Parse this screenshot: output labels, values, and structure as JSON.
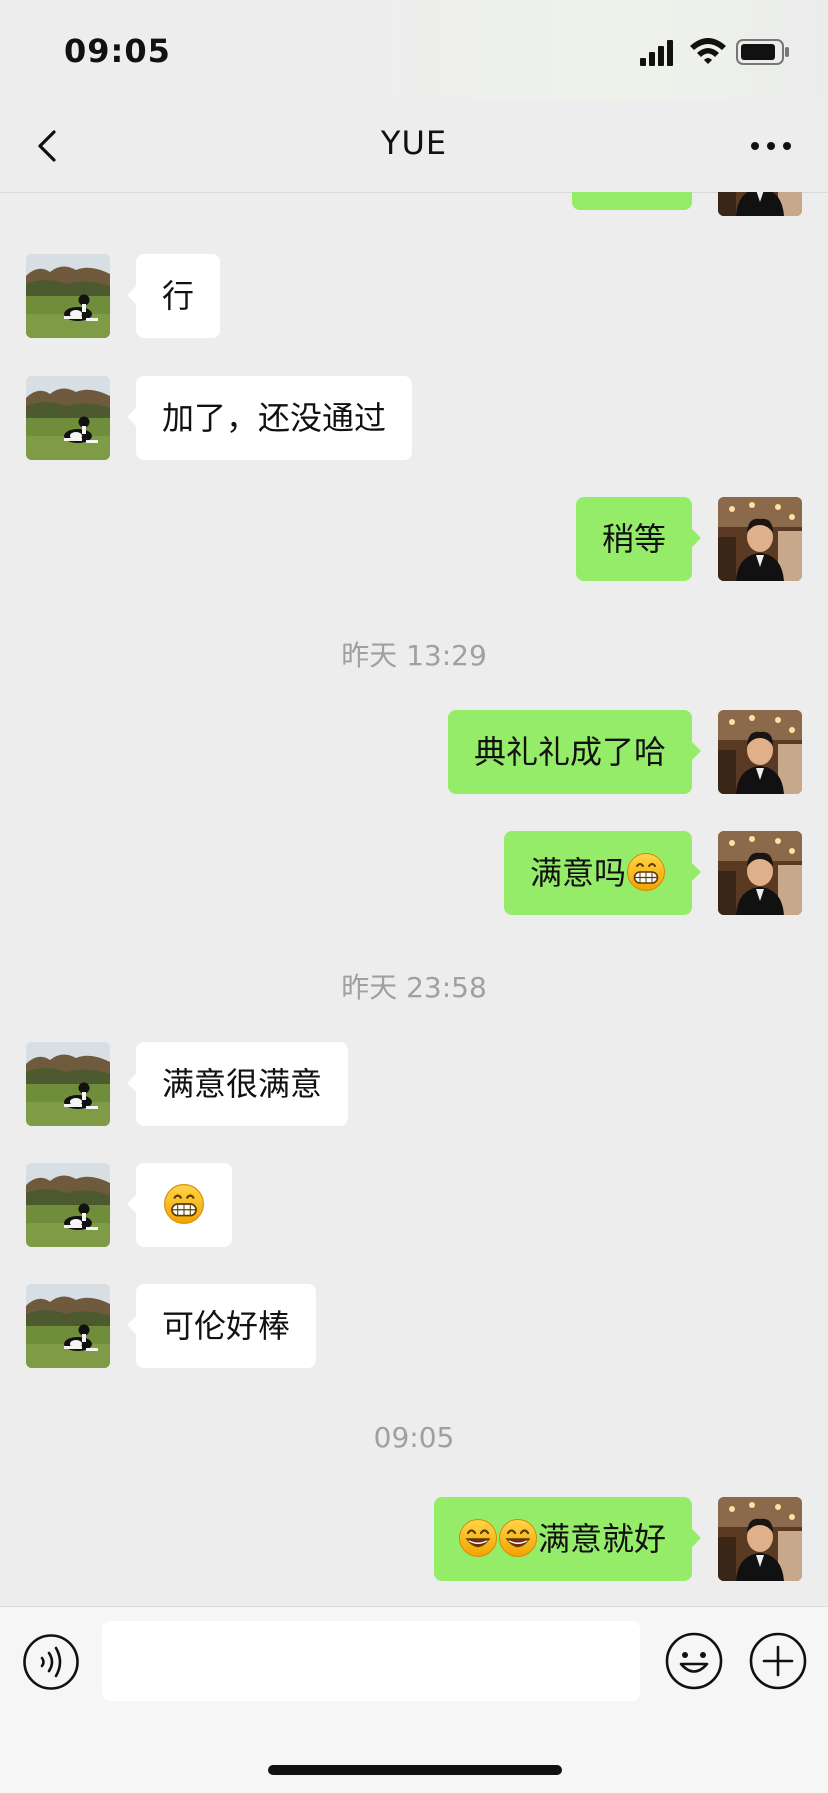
{
  "status_bar": {
    "time": "09:05",
    "icons": [
      "signal-icon",
      "wifi-icon",
      "battery-icon"
    ]
  },
  "header": {
    "title": "YUE",
    "back_icon": "chevron-left-icon",
    "more_icon": "more-dots-icon"
  },
  "colors": {
    "background": "#ededed",
    "sent_bubble": "#95ec69",
    "received_bubble": "#ffffff",
    "timestamp": "#a0a0a0"
  },
  "messages": [
    {
      "sender": "contact",
      "text": "行"
    },
    {
      "sender": "contact",
      "text": "加了，还没通过"
    },
    {
      "sender": "me",
      "text": "稍等"
    },
    {
      "type": "timestamp",
      "text": "昨天 13:29"
    },
    {
      "sender": "me",
      "text": "典礼礼成了哈"
    },
    {
      "sender": "me",
      "text": "满意吗",
      "emoji": "grinning-face-icon"
    },
    {
      "type": "timestamp",
      "text": "昨天 23:58"
    },
    {
      "sender": "contact",
      "text": "满意很满意"
    },
    {
      "sender": "contact",
      "text": "",
      "emoji": "grinning-face-icon"
    },
    {
      "sender": "contact",
      "text": "可伦好棒"
    },
    {
      "type": "timestamp",
      "text": "09:05"
    },
    {
      "sender": "me",
      "text": "满意就好",
      "emoji": "smiling-face-icon"
    }
  ],
  "input_bar": {
    "voice_icon": "voice-icon",
    "input_value": "",
    "emoji_icon": "emoji-icon",
    "plus_icon": "plus-icon"
  }
}
